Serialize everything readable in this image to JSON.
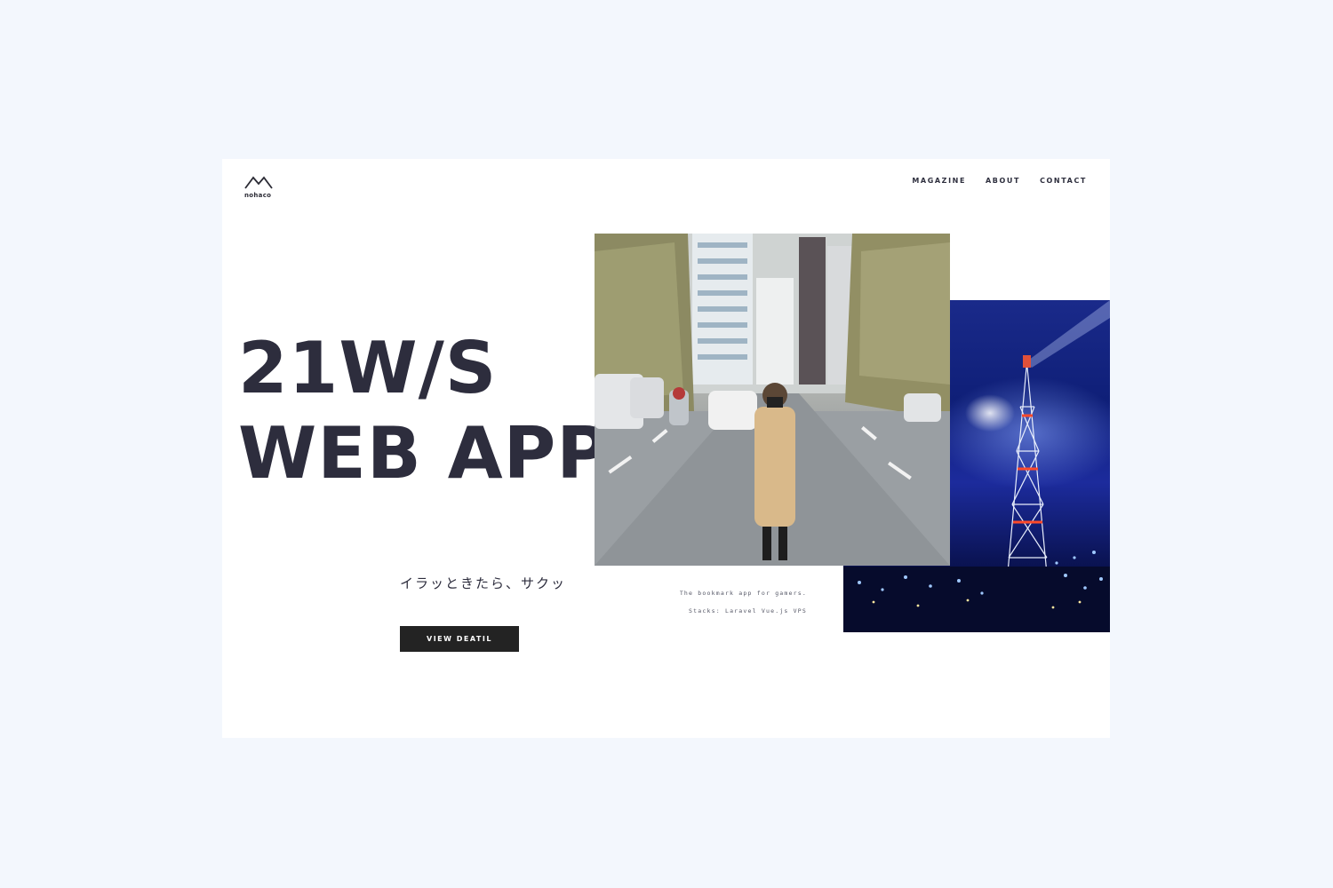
{
  "brand": {
    "name": "nohaco",
    "logo_icon": "mountain-logo-icon"
  },
  "nav": {
    "items": [
      "MAGAZINE",
      "ABOUT",
      "CONTACT"
    ]
  },
  "hero": {
    "title_line1": "21W/S",
    "title_line2": "WEB APP",
    "tagline": "イラッときたら、サクッ",
    "caption_line1": "The bookmark app for gamers.",
    "caption_line2": "Stacks: Laravel Vue.js VPS",
    "cta_label": "VIEW DEATIL"
  },
  "colors": {
    "page_background": "#f3f7fd",
    "card_background": "#ffffff",
    "headline": "#2d2d3d",
    "button": "#232323"
  }
}
